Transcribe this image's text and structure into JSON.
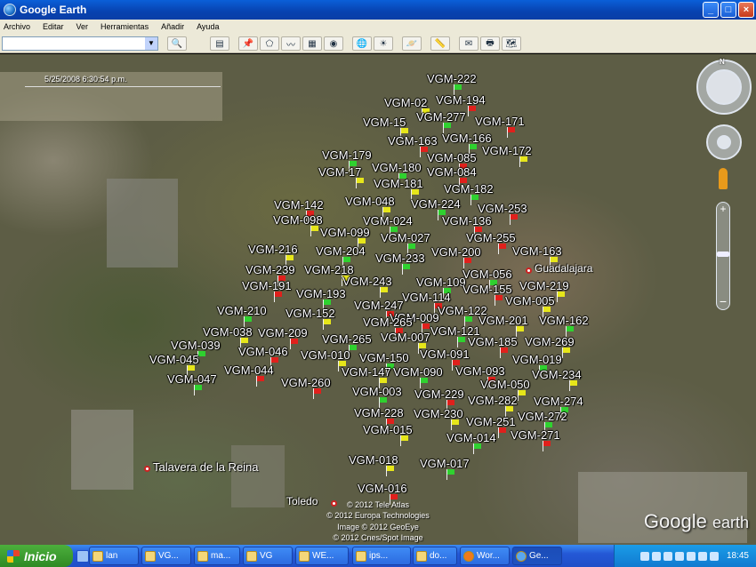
{
  "window": {
    "title": "Google Earth",
    "controls": [
      "_",
      "□",
      "×"
    ]
  },
  "menu": [
    "Archivo",
    "Editar",
    "Ver",
    "Herramientas",
    "Añadir",
    "Ayuda"
  ],
  "search": {
    "value": "",
    "dropdown_icon": "chevron-down-icon"
  },
  "timeline": {
    "date_label": "5/25/2008 6:30:54 p.m."
  },
  "cities": [
    {
      "name": "Guadalajara"
    },
    {
      "name": "Talavera de la Reina"
    },
    {
      "name": "Toledo"
    }
  ],
  "markers": [
    "VGM-222",
    "VGM-194",
    "VGM-02",
    "VGM-277",
    "VGM-171",
    "VGM-15",
    "VGM-166",
    "VGM-163",
    "VGM-172",
    "VGM-179",
    "VGM-085",
    "VGM-17",
    "VGM-180",
    "VGM-084",
    "VGM-181",
    "VGM-182",
    "VGM-142",
    "VGM-048",
    "VGM-224",
    "VGM-253",
    "VGM-098",
    "VGM-024",
    "VGM-136",
    "VGM-099",
    "VGM-027",
    "VGM-255",
    "VGM-216",
    "VGM-204",
    "VGM-200",
    "VGM-163",
    "VGM-233",
    "VGM-239",
    "VGM-218",
    "VGM-056",
    "VGM-191",
    "VGM-243",
    "VGM-109",
    "VGM-155",
    "VGM-219",
    "VGM-193",
    "VGM-114",
    "VGM-005",
    "VGM-210",
    "VGM-247",
    "VGM-152",
    "VGM-122",
    "VGM-009",
    "VGM-201",
    "VGM-162",
    "VGM-265",
    "VGM-038",
    "VGM-121",
    "VGM-209",
    "VGM-007",
    "VGM-265",
    "VGM-185",
    "VGM-269",
    "VGM-039",
    "VGM-046",
    "VGM-010",
    "VGM-150",
    "VGM-091",
    "VGM-045",
    "VGM-019",
    "VGM-044",
    "VGM-147",
    "VGM-090",
    "VGM-093",
    "VGM-234",
    "VGM-047",
    "VGM-260",
    "VGM-050",
    "VGM-003",
    "VGM-229",
    "VGM-282",
    "VGM-274",
    "VGM-228",
    "VGM-230",
    "VGM-272",
    "VGM-251",
    "VGM-015",
    "VGM-014",
    "VGM-271",
    "VGM-018",
    "VGM-017",
    "VGM-016"
  ],
  "credits": [
    "© 2012 Tele Atlas",
    "© 2012 Europa Technologies",
    "Image © 2012 GeoEye",
    "© 2012 Cnes/Spot Image"
  ],
  "logo": {
    "text": "Google",
    "suffix": "earth"
  },
  "taskbar": {
    "start_label": "Inicio",
    "tasks": [
      "lan",
      "VG...",
      "ma...",
      "VG",
      "WE...",
      "ips...",
      "do...",
      "Wor...",
      "Ge..."
    ],
    "clock": "18:45"
  },
  "colors": {
    "accent": "#0a5fd8",
    "flag_green": "#2fd12f",
    "flag_red": "#e0201c",
    "flag_yellow": "#e6e61a"
  }
}
